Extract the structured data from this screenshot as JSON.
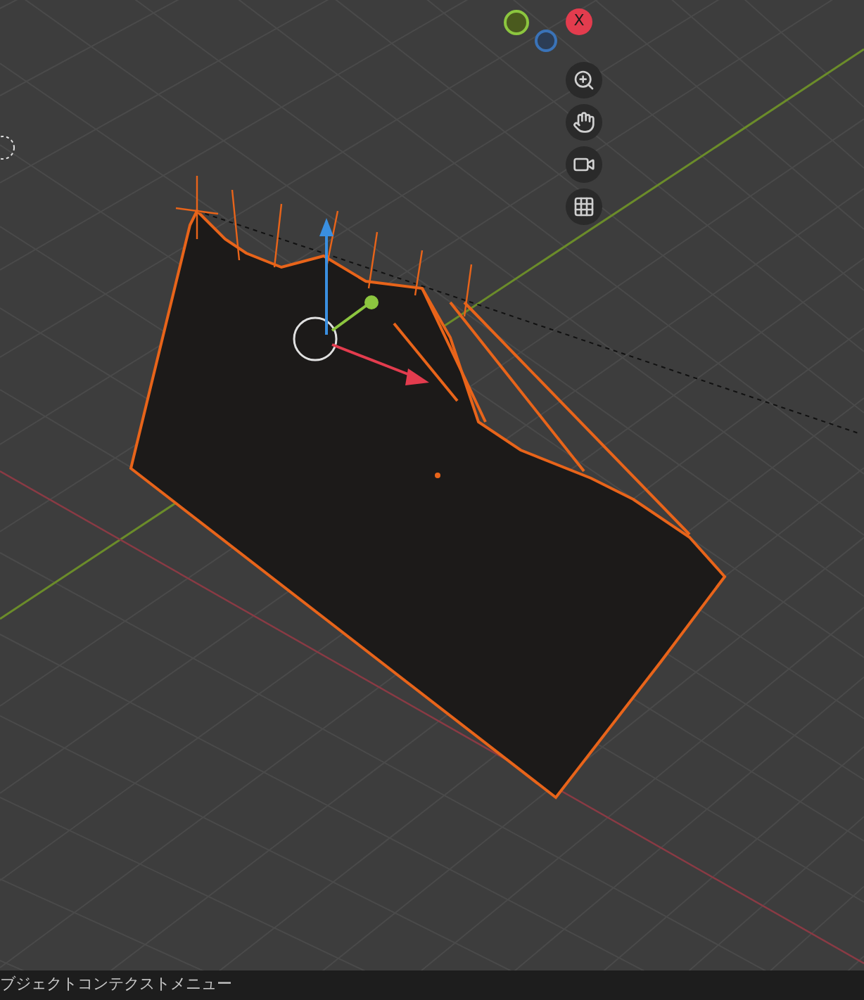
{
  "viewport": {
    "axis_gizmo": {
      "x_label": "X"
    }
  },
  "status_bar": {
    "text": "ブジェクトコンテクストメニュー"
  }
}
